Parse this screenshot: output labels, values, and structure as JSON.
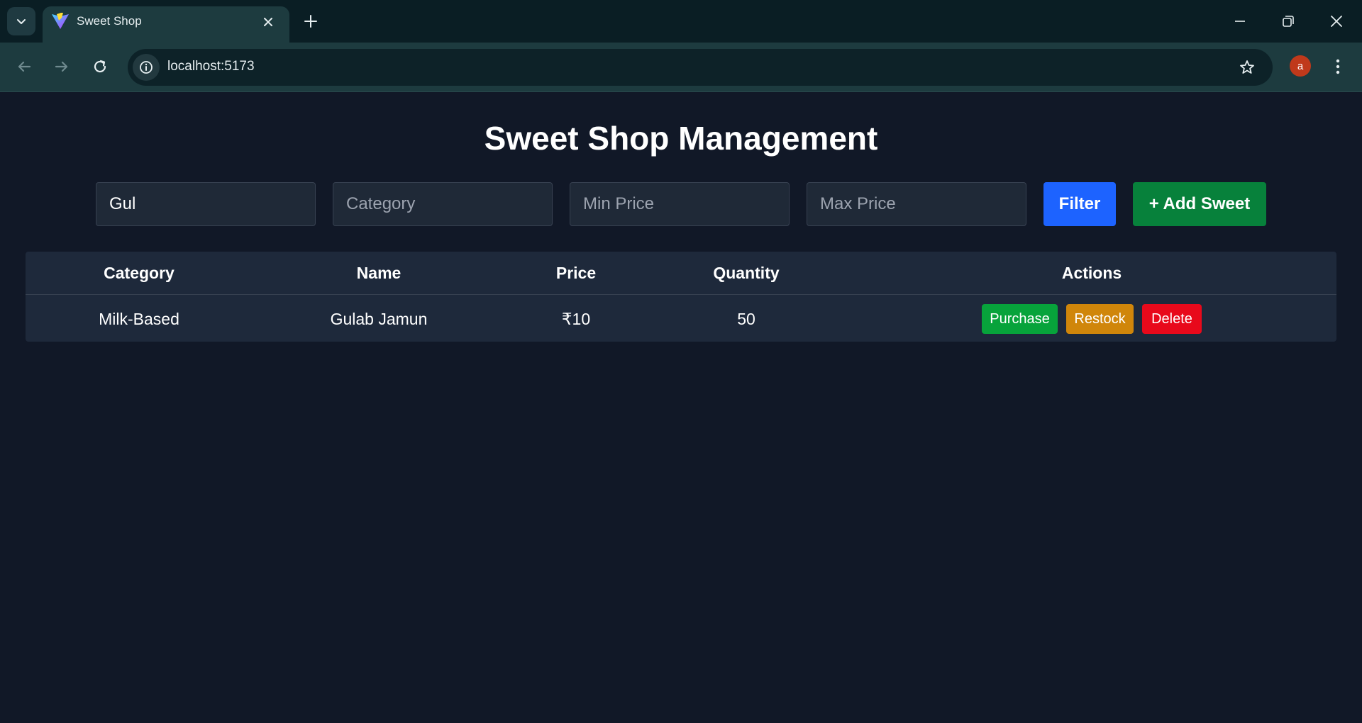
{
  "browser": {
    "tab_title": "Sweet Shop",
    "url": "localhost:5173",
    "profile_initial": "a",
    "colors": {
      "tabstrip": "#0a1e24",
      "toolbar": "#1d3b3f",
      "avatar": "#c0391b"
    }
  },
  "page": {
    "title": "Sweet Shop Management",
    "filters": {
      "name": {
        "value": "Gul",
        "placeholder": ""
      },
      "category": {
        "value": "",
        "placeholder": "Category"
      },
      "min_price": {
        "value": "",
        "placeholder": "Min Price"
      },
      "max_price": {
        "value": "",
        "placeholder": "Max Price"
      },
      "filter_label": "Filter",
      "add_label": "+ Add Sweet"
    },
    "table": {
      "headers": {
        "category": "Category",
        "name": "Name",
        "price": "Price",
        "quantity": "Quantity",
        "actions": "Actions"
      },
      "rows": [
        {
          "category": "Milk-Based",
          "name": "Gulab Jamun",
          "price": "₹10",
          "quantity": "50",
          "actions": {
            "purchase": "Purchase",
            "restock": "Restock",
            "delete": "Delete"
          }
        }
      ]
    },
    "colors": {
      "background": "#111827",
      "filter_button": "#1d63ff",
      "add_button": "#07813b",
      "purchase": "#07a33b",
      "restock": "#d0860a",
      "delete": "#e8091b"
    }
  }
}
